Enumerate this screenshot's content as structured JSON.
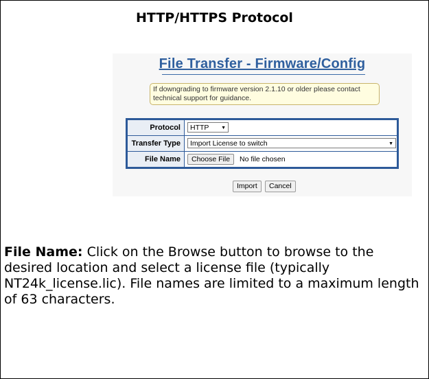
{
  "heading": "HTTP/HTTPS Protocol",
  "screenshot": {
    "title": "File Transfer - Firmware/Config",
    "notice": "If downgrading to firmware version 2.1.10 or older please contact technical support for guidance.",
    "rows": [
      {
        "label": "Protocol",
        "value": "HTTP"
      },
      {
        "label": "Transfer Type",
        "value": "Import License to switch"
      },
      {
        "label": "File Name",
        "button": "Choose File",
        "status": "No file chosen"
      }
    ],
    "buttons": {
      "import": "Import",
      "cancel": "Cancel"
    },
    "colors": {
      "title": "#2f5f9e",
      "table_border": "#2d5a99",
      "notice_bg": "#fffde0"
    }
  },
  "description": {
    "term": "File Name:",
    "text": "Click on the Browse button to browse to the desired location and select a license file (typically NT24k_license.lic). File names are limited to a maximum length of 63 characters."
  }
}
